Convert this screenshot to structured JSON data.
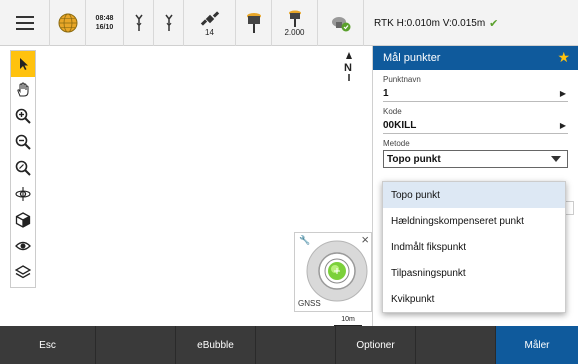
{
  "statusbar": {
    "time": "08:48",
    "date": "16/10",
    "satellites": "14",
    "pole_height": "2.000",
    "rtk_status": "RTK H:0.010m V:0.015m"
  },
  "map": {
    "north_label": "N",
    "gnss_label": "GNSS",
    "scale_label": "10m"
  },
  "panel": {
    "title": "Mål punkter",
    "point_name_label": "Punktnavn",
    "point_name_value": "1",
    "code_label": "Kode",
    "code_value": "00KILL",
    "method_label": "Metode",
    "method_value": "Topo punkt",
    "method_options": [
      "Topo punkt",
      "Hældningskompenseret punkt",
      "Indmålt fikspunkt",
      "Tilpasningspunkt",
      "Kvikpunkt"
    ]
  },
  "bottombar": {
    "esc": "Esc",
    "ebubble": "eBubble",
    "options": "Optioner",
    "measure": "Måler"
  },
  "colors": {
    "accent": "#0f5a9c",
    "active_tool": "#ffc20e",
    "ok": "#5aa02c"
  }
}
